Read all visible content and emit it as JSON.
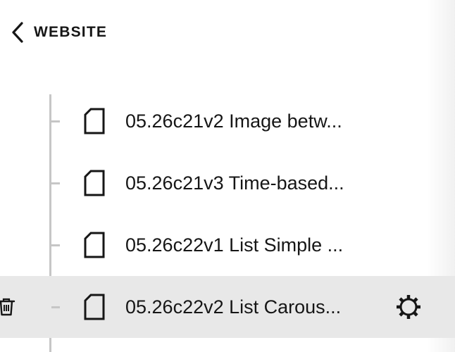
{
  "header": {
    "back_label": "WEBSITE",
    "back_icon": "chevron-left-icon"
  },
  "pages": [
    {
      "title": "05.26c21v2 Image betw...",
      "icon": "page-icon",
      "selected": false
    },
    {
      "title": "05.26c21v3 Time-based...",
      "icon": "page-icon",
      "selected": false
    },
    {
      "title": "05.26c22v1 List Simple ...",
      "icon": "page-icon",
      "selected": false
    },
    {
      "title": "05.26c22v2 List Carous...",
      "icon": "page-icon",
      "selected": true,
      "actions": [
        "trash-icon",
        "gear-icon"
      ]
    }
  ],
  "colors": {
    "selected_row": "#e8e8e8",
    "tree_line": "#c6c6c6",
    "text": "#161616"
  }
}
